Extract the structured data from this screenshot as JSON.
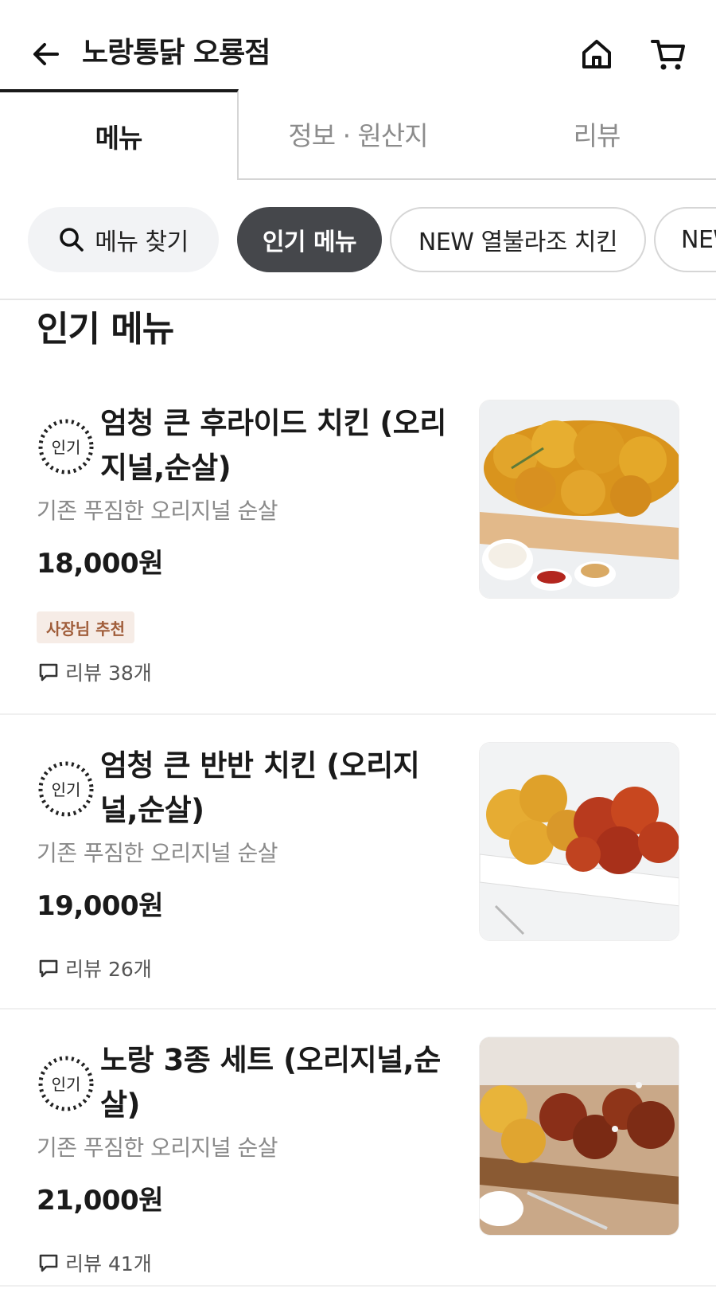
{
  "header": {
    "store_name": "노랑통닭 오룡점",
    "back_icon": "back-arrow-icon",
    "home_icon": "home-icon",
    "cart_icon": "cart-icon"
  },
  "tabs": [
    {
      "label": "메뉴",
      "active": true
    },
    {
      "label": "정보 · 원산지",
      "active": false
    },
    {
      "label": "리뷰",
      "active": false
    }
  ],
  "chips": {
    "search_label": "메뉴 찾기",
    "items": [
      {
        "label": "인기 메뉴",
        "active": true
      },
      {
        "label": "NEW 열불라조 치킨",
        "active": false
      },
      {
        "label": "NEW",
        "active": false
      }
    ]
  },
  "section": {
    "title": "인기 메뉴"
  },
  "menu_items": [
    {
      "badge": "인기",
      "name": "엄청 큰 후라이드 치킨 (오리지널,순살)",
      "name_line1": "엄청 큰 후라이드 치킨 (오리",
      "name_line2": "지널,순살)",
      "description": "기존 푸짐한 오리지널 순살",
      "price": "18,000원",
      "tag": "사장님 추천",
      "review": "리뷰 38개"
    },
    {
      "badge": "인기",
      "name": "엄청 큰 반반 치킨 (오리지널,순살)",
      "name_line1": "엄청 큰 반반 치킨 (오리지",
      "name_line2": "널,순살)",
      "description": "기존 푸짐한 오리지널 순살",
      "price": "19,000원",
      "tag": "",
      "review": "리뷰 26개"
    },
    {
      "badge": "인기",
      "name": "노랑 3종 세트 (오리지널,순살)",
      "name_line1": "노랑 3종 세트 (오리지널,순",
      "name_line2": "살)",
      "description": "기존 푸짐한 오리지널 순살",
      "price": "21,000원",
      "tag": "",
      "review": "리뷰 41개"
    }
  ],
  "colors": {
    "accent_dark": "#45474b",
    "tag_bg": "#f6ece6",
    "tag_text": "#a05d3a",
    "muted_text": "#8a8a8a"
  }
}
